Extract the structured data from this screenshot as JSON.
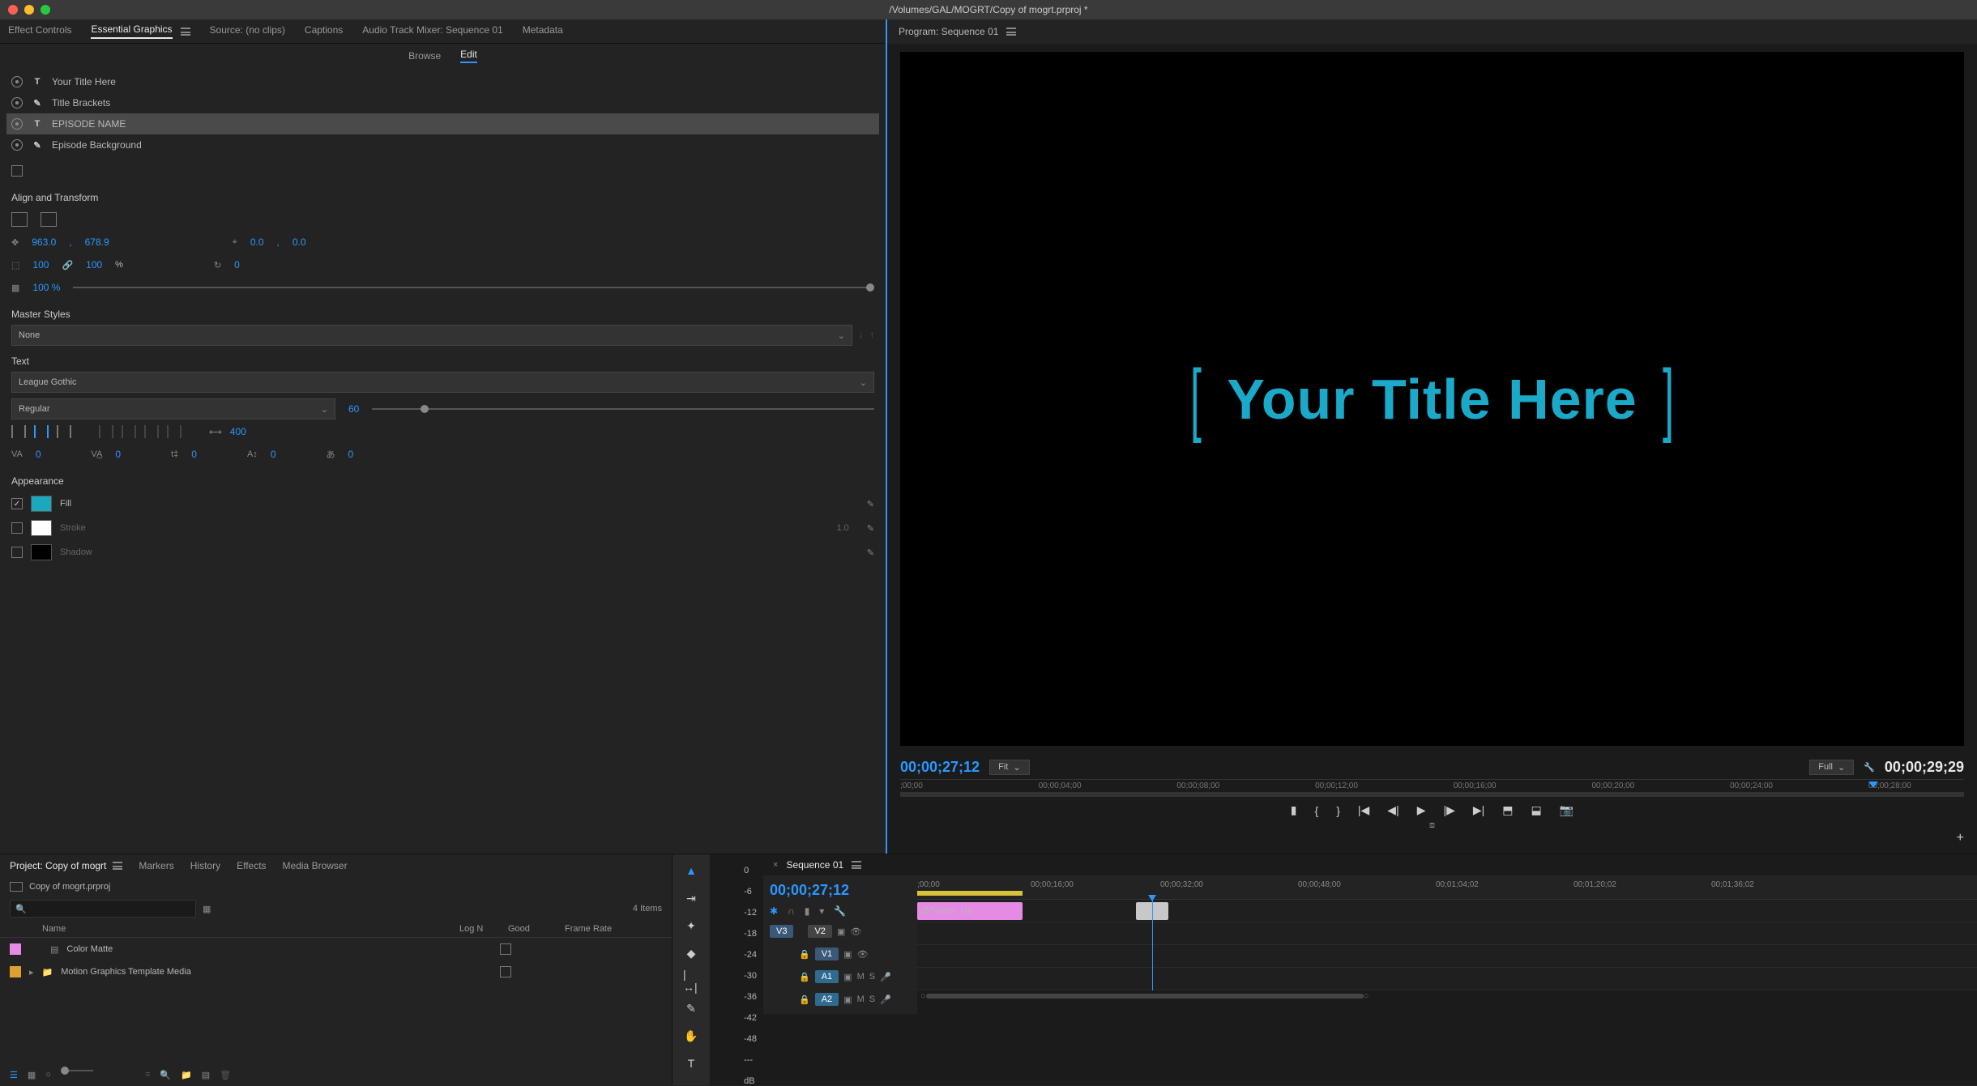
{
  "window_title": "/Volumes/GAL/MOGRT/Copy of mogrt.prproj *",
  "top_tabs": {
    "effect_controls": "Effect Controls",
    "essential_graphics": "Essential Graphics",
    "source": "Source: (no clips)",
    "captions": "Captions",
    "audio_mixer": "Audio Track Mixer: Sequence 01",
    "metadata": "Metadata"
  },
  "eg_subtabs": {
    "browse": "Browse",
    "edit": "Edit"
  },
  "layers": [
    {
      "name": "Your Title Here",
      "icon": "T"
    },
    {
      "name": "Title Brackets",
      "icon": "✎"
    },
    {
      "name": "EPISODE NAME",
      "icon": "T",
      "selected": true
    },
    {
      "name": "Episode Background",
      "icon": "✎"
    }
  ],
  "align_transform": {
    "title": "Align and Transform",
    "pos_x": "963.0",
    "pos_y": "678.9",
    "anchor_x": "0.0",
    "anchor_y": "0.0",
    "scale_w": "100",
    "scale_h": "100",
    "pct": "%",
    "rotation": "0",
    "opacity": "100 %"
  },
  "master_styles": {
    "title": "Master Styles",
    "value": "None"
  },
  "text": {
    "title": "Text",
    "font": "League Gothic",
    "weight": "Regular",
    "size": "60",
    "tracking": "400",
    "metrics": {
      "kern": "0",
      "lead": "0",
      "baseline": "0",
      "tsume": "0",
      "last": "0"
    }
  },
  "appearance": {
    "title": "Appearance",
    "fill_label": "Fill",
    "stroke_label": "Stroke",
    "stroke_width": "1.0",
    "shadow_label": "Shadow",
    "fill_color": "#1aa8bd",
    "stroke_color": "#ffffff",
    "shadow_color": "#000000"
  },
  "program": {
    "title_label": "Program: Sequence 01",
    "title_graphic": "Your Title Here",
    "current_tc": "00;00;27;12",
    "fit": "Fit",
    "quality": "Full",
    "duration_tc": "00;00;29;29",
    "ruler_ticks": [
      ";00;00",
      "00;00;04;00",
      "00;00;08;00",
      "00;00;12;00",
      "00;00;16;00",
      "00;00;20;00",
      "00;00;24;00",
      "00;00;28;00"
    ]
  },
  "project": {
    "tabs": {
      "project": "Project: Copy of mogrt",
      "markers": "Markers",
      "history": "History",
      "effects": "Effects",
      "media_browser": "Media Browser"
    },
    "filename": "Copy of mogrt.prproj",
    "items_count": "4 Items",
    "cols": {
      "name": "Name",
      "logn": "Log N",
      "good": "Good",
      "frame_rate": "Frame Rate"
    },
    "rows": [
      {
        "color": "#e58ae5",
        "name": "Color Matte"
      },
      {
        "color": "#e0a030",
        "name": "Motion Graphics Template Media"
      }
    ]
  },
  "timeline": {
    "sequence_tab": "Sequence 01",
    "timecode": "00;00;27;12",
    "ruler_ticks": [
      ";00;00",
      "00;00;16;00",
      "00;00;32;00",
      "00;00;48;00",
      "00;01;04;02",
      "00;01;20;02",
      "00;01;36;02"
    ],
    "tracks": {
      "v3": "V3",
      "v2": "V2",
      "v1": "V1",
      "a1": "A1",
      "a2": "A2"
    },
    "clips": {
      "twitter": "@Twitter_Ha"
    },
    "btns": {
      "m": "M",
      "s": "S"
    }
  },
  "meter_scale": [
    "0",
    "-6",
    "-12",
    "-18",
    "-24",
    "-30",
    "-36",
    "-42",
    "-48",
    "---",
    "dB"
  ]
}
